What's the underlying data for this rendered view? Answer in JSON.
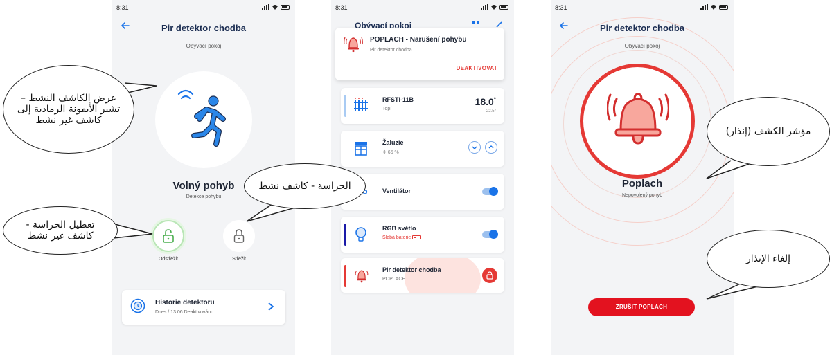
{
  "status_bar": {
    "time": "8:31"
  },
  "screen1": {
    "title": "Pir detektor chodba",
    "room": "Obývací pokoj",
    "state_title": "Volný pohyb",
    "state_sub": "Detekce pohybu",
    "disarm_label": "Odstřežit",
    "arm_label": "Střežit",
    "history": {
      "title": "Historie detektoru",
      "sub": "Dnes / 13:06  Deaktivováno"
    }
  },
  "screen2": {
    "header_title": "Obývací pokoj",
    "alarm": {
      "title": "POPLACH - Narušení pohybu",
      "sub": "Pir detektor chodba",
      "action": "DEAKTIVOVAT"
    },
    "devices": [
      {
        "name": "RFSTI-11B",
        "sub": "Topí",
        "value": "18.0",
        "unit": "°",
        "target": "22.5°"
      },
      {
        "name": "Žaluzie",
        "sub": "⇕ 65 %"
      },
      {
        "name": "Ventilátor"
      },
      {
        "name": "RGB světlo",
        "sub": "Slabá baterie"
      },
      {
        "name": "Pir detektor chodba",
        "sub": "POPLACH"
      }
    ]
  },
  "screen3": {
    "title": "Pir detektor chodba",
    "room": "Obývací pokoj",
    "state_title": "Poplach",
    "state_sub": "Nepovolený pohyb",
    "cancel_label": "ZRUŠIT POPLACH"
  },
  "callouts": {
    "active_detector": "عرض الكاشف النشط – تشير الأيقونة الرمادية إلى كاشف غير نشط",
    "guard_active": "الحراسة - كاشف نشط",
    "disable_guard": "تعطيل الحراسة - كاشف غير نشط",
    "detection_indicator": "مؤشر الكشف (إنذار)",
    "cancel_alarm": "إلغاء الإنذار"
  },
  "colors": {
    "primary": "#1a73e8",
    "alarm": "#e53935",
    "armed_green": "#5cbf5c",
    "background": "#f3f4f6"
  }
}
